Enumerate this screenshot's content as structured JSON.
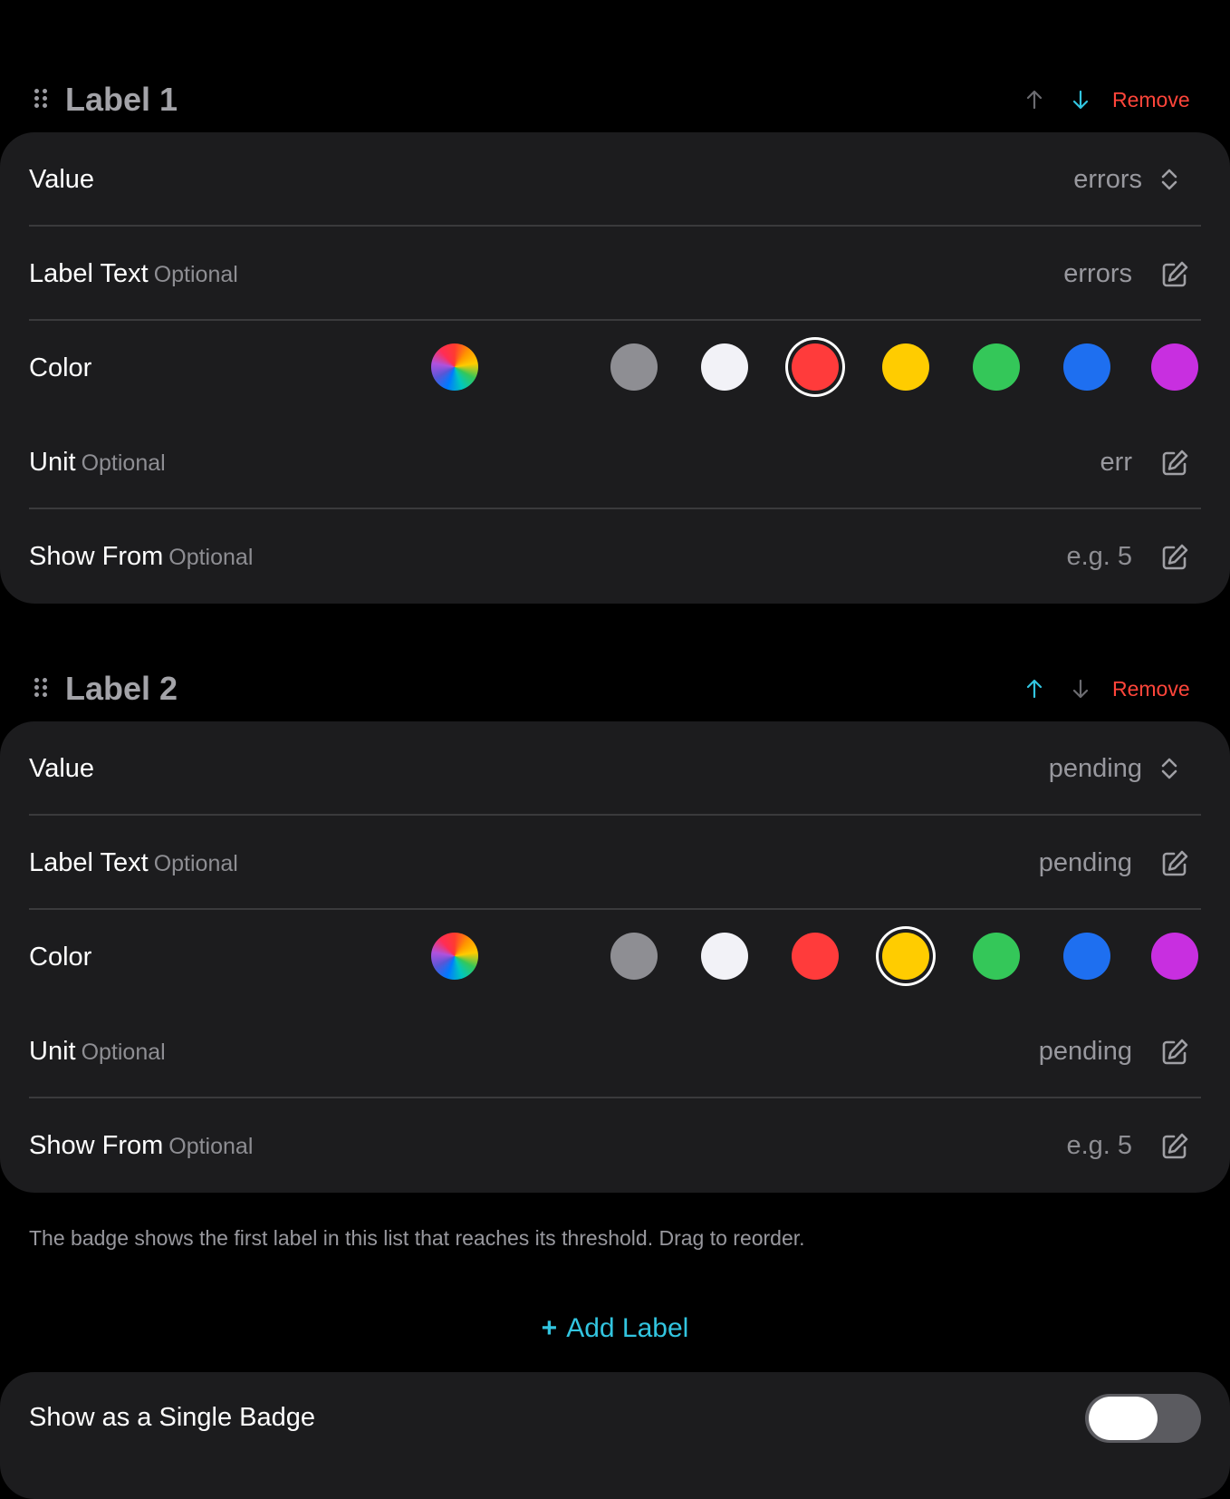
{
  "colors": {
    "accent": "#32c5e0",
    "destructive": "#ff453a",
    "card_background": "#1c1c1e",
    "page_background": "#000000",
    "arrow_disabled": "#6b6b70"
  },
  "color_swatches": [
    {
      "name": "custom",
      "color": "conic-gradient"
    },
    {
      "name": "gray",
      "color": "#8e8e93"
    },
    {
      "name": "white",
      "color": "#f2f2f7"
    },
    {
      "name": "red",
      "color": "#ff3b3b"
    },
    {
      "name": "yellow",
      "color": "#ffcc00"
    },
    {
      "name": "green",
      "color": "#34c759"
    },
    {
      "name": "blue",
      "color": "#1e6ff0"
    },
    {
      "name": "purple",
      "color": "#c82fe0"
    }
  ],
  "labels": [
    {
      "title": "Label 1",
      "up_enabled": false,
      "down_enabled": true,
      "remove_label": "Remove",
      "value_label": "Value",
      "value": "errors",
      "label_text_label": "Label Text",
      "label_text_optional": "Optional",
      "label_text_value": "errors",
      "color_label": "Color",
      "selected_color": "red",
      "unit_label": "Unit",
      "unit_optional": "Optional",
      "unit_value": "err",
      "show_from_label": "Show From",
      "show_from_optional": "Optional",
      "show_from_placeholder": "e.g. 5"
    },
    {
      "title": "Label 2",
      "up_enabled": true,
      "down_enabled": false,
      "remove_label": "Remove",
      "value_label": "Value",
      "value": "pending",
      "label_text_label": "Label Text",
      "label_text_optional": "Optional",
      "label_text_value": "pending",
      "color_label": "Color",
      "selected_color": "yellow",
      "unit_label": "Unit",
      "unit_optional": "Optional",
      "unit_value": "pending",
      "show_from_label": "Show From",
      "show_from_optional": "Optional",
      "show_from_placeholder": "e.g. 5"
    }
  ],
  "footer_note": "The badge shows the first label in this list that reaches its threshold. Drag to reorder.",
  "add_label": {
    "plus": "+",
    "text": "Add Label"
  },
  "single_badge": {
    "label": "Show as a Single Badge",
    "on": false
  }
}
